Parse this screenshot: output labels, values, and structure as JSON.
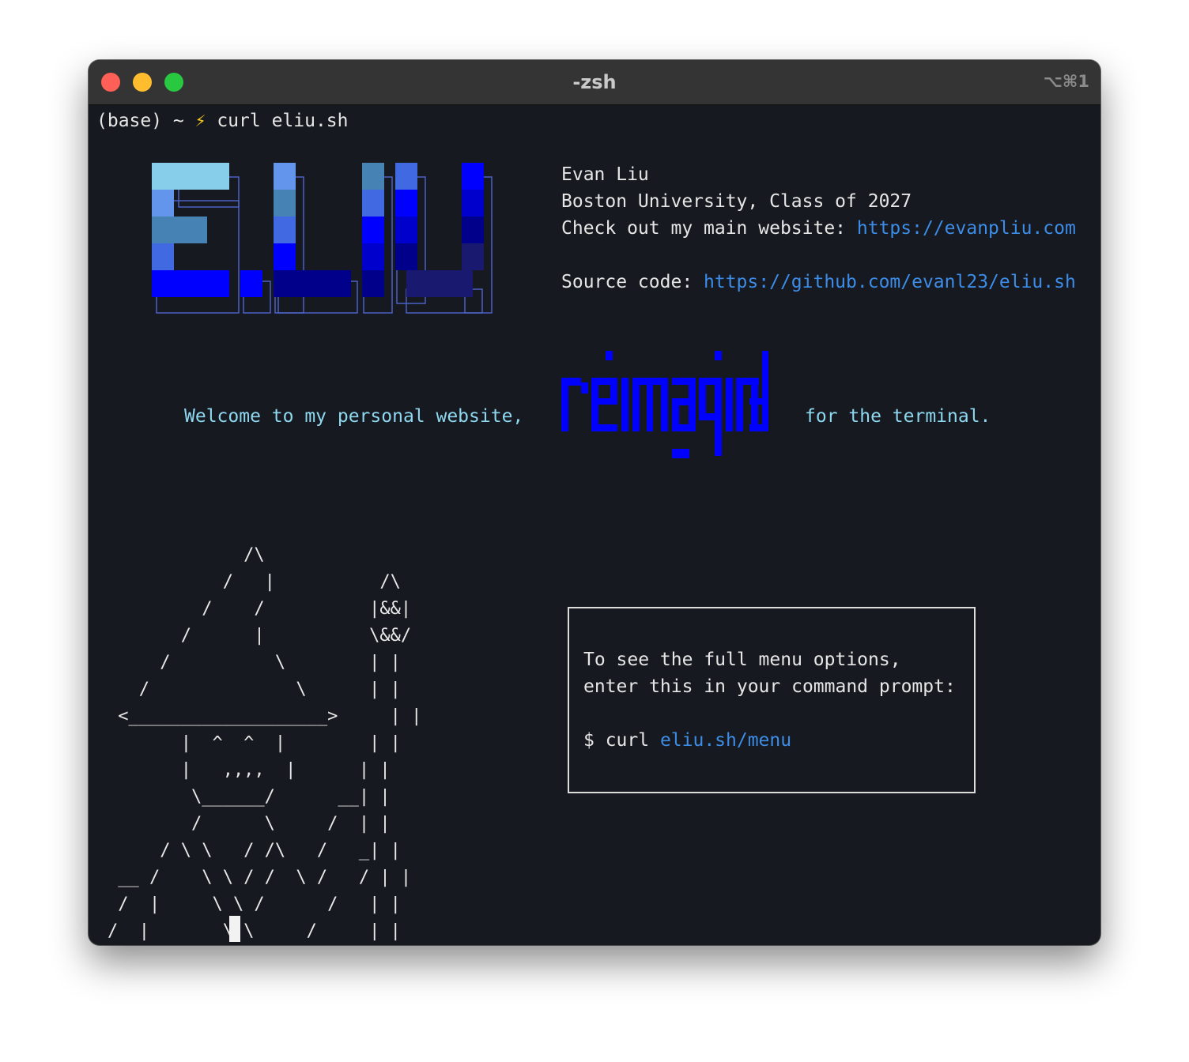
{
  "window": {
    "title": "-zsh",
    "shortcut": "⌥⌘1"
  },
  "prompt": {
    "prefix": "(base) ~ ",
    "icon": "lightning-bolt-icon",
    "bolt": "⚡",
    "command": " curl eliu.sh"
  },
  "logo": {
    "text": "E.LIU",
    "colors": [
      "#87ceeb",
      "#6495ed",
      "#4682b4",
      "#4169e1",
      "#0000ff",
      "#0000cd",
      "#00008b",
      "#191970"
    ]
  },
  "info": {
    "name": "Evan Liu",
    "school": "Boston University, Class of 2027",
    "website_label": "Check out my main website: ",
    "website_url": "https://evanpliu.com",
    "source_label": "Source code: ",
    "source_url": "https://github.com/evanl23/eliu.sh"
  },
  "welcome": {
    "before": "Welcome to my personal website,",
    "highlight": "reimagined",
    "after": "for the terminal."
  },
  "ascii_art": "             /\\\n           /   |          /\\\n         /    /          |&&|\n       /      |          \\&&/\n     /          \\        | |\n   /              \\      | |\n <___________________>     | |\n       |  ^  ^  |        | |\n       |   ,,,,  |      | |\n        \\______/      __| |\n        /      \\     /  | |\n     / \\ \\   / /\\   /   _| |\n __ /    \\ \\ / /  \\ /   / | |\n /  |     \\ \\ /      /   | |\n/  |       \\ \\     /     | |\n/  /|        \\ \\    |      | |",
  "menu": {
    "line1": "To see the full menu options,",
    "line2": "enter this in your command prompt:",
    "cmd_prefix": "$ curl ",
    "cmd_url": "eliu.sh/menu"
  },
  "colors": {
    "background": "#16191f",
    "link": "#3d8de8",
    "welcome": "#8ed8f0",
    "reimagined": "#0000ff"
  }
}
